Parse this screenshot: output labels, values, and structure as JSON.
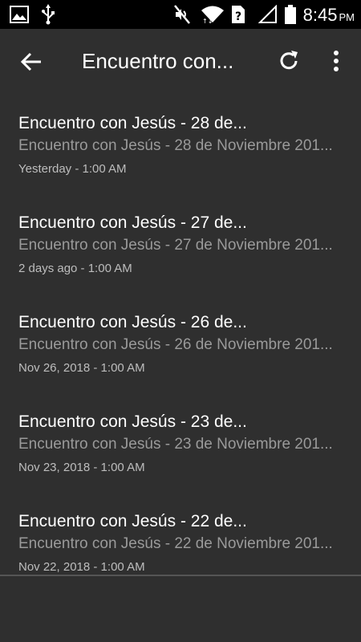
{
  "status_bar": {
    "time": "8:45",
    "ampm": "PM",
    "icons": [
      "image-icon",
      "usb-icon",
      "mute-icon",
      "wifi-icon",
      "sim-icon",
      "signal-icon",
      "battery-icon"
    ]
  },
  "app_bar": {
    "title": "Encuentro con...",
    "back_icon": "arrow-back-icon",
    "refresh_icon": "refresh-icon",
    "more_icon": "more-vert-icon"
  },
  "items": [
    {
      "title": "Encuentro con Jesús - 28 de...",
      "subtitle": "Encuentro con Jesús - 28 de Noviembre 201...",
      "date": "Yesterday - 1:00 AM"
    },
    {
      "title": "Encuentro con Jesús - 27 de...",
      "subtitle": "Encuentro con Jesús - 27 de Noviembre 201...",
      "date": "2 days ago - 1:00 AM"
    },
    {
      "title": "Encuentro con Jesús - 26 de...",
      "subtitle": "Encuentro con Jesús - 26 de Noviembre 201...",
      "date": "Nov 26, 2018 - 1:00 AM"
    },
    {
      "title": "Encuentro con Jesús - 23 de...",
      "subtitle": "Encuentro con Jesús - 23 de Noviembre 201...",
      "date": "Nov 23, 2018 - 1:00 AM"
    },
    {
      "title": "Encuentro con Jesús - 22 de...",
      "subtitle": "Encuentro con Jesús - 22 de Noviembre 201...",
      "date": "Nov 22, 2018 - 1:00 AM"
    }
  ]
}
